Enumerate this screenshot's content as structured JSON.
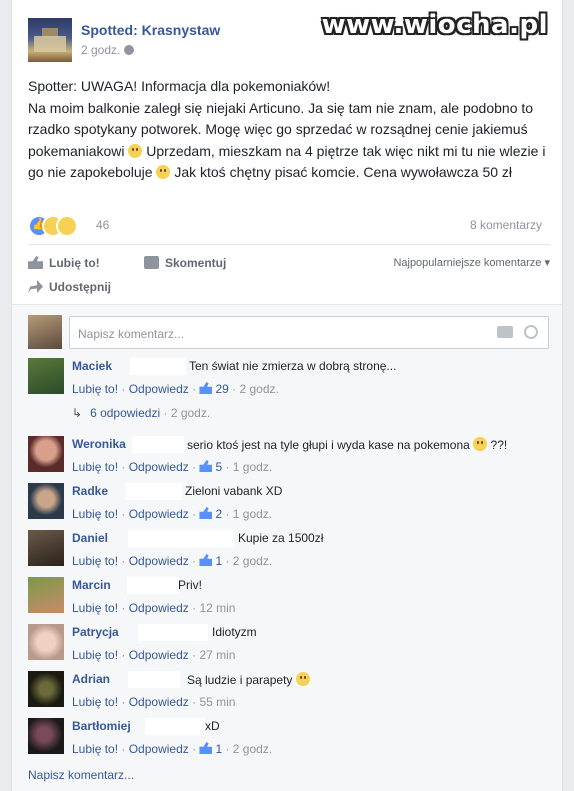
{
  "watermark": "www.wiocha.pl",
  "post": {
    "page_name": "Spotted: Krasnystaw",
    "time": "2 godz.",
    "text_p1": "Spotter: UWAGA! Informacja dla pokemoniaków!",
    "text_p2a": "Na moim balkonie zaległ się niejaki Articuno. Ja się tam nie znam, ale podobno to rzadko spotykany potworek. Mogę więc go sprzedać w rozsądnej cenie jakiemuś pokemaniakowi",
    "text_p2b": "Uprzedam, mieszkam na 4 piętrze tak więc nikt mi tu nie wlezie i go nie zapokeboluje",
    "text_p2c": "Jak ktoś chętny pisać komcie. Cena wywoławcza 50 zł",
    "reactions_count": "46",
    "comments_count": "8 komentarzy"
  },
  "actions": {
    "like": "Lubię to!",
    "comment": "Skomentuj",
    "share": "Udostępnij",
    "sort": "Najpopularniejsze komentarze"
  },
  "composer": {
    "placeholder": "Napisz komentarz..."
  },
  "comments": [
    {
      "name": "Maciek",
      "text": "Ten świat nie zmierza w dobrą stronę...",
      "like": "Lubię to!",
      "reply": "Odpowiedz",
      "likes": "29",
      "time": "2 godz."
    },
    {
      "name": "Weronika",
      "text": "serio ktoś jest na tyle głupi i wyda kase na pokemona",
      "text_after": "??!",
      "like": "Lubię to!",
      "reply": "Odpowiedz",
      "likes": "5",
      "time": "1 godz."
    },
    {
      "name": "Radke",
      "text": "Zieloni vabank XD",
      "like": "Lubię to!",
      "reply": "Odpowiedz",
      "likes": "2",
      "time": "1 godz."
    },
    {
      "name": "Daniel",
      "text": "Kupie za 1500zł",
      "like": "Lubię to!",
      "reply": "Odpowiedz",
      "likes": "1",
      "time": "2 godz."
    },
    {
      "name": "Marcin",
      "text": "Priv!",
      "like": "Lubię to!",
      "reply": "Odpowiedz",
      "likes": "",
      "time": "12 min"
    },
    {
      "name": "Patrycja",
      "text": "Idiotyzm",
      "like": "Lubię to!",
      "reply": "Odpowiedz",
      "likes": "",
      "time": "27 min"
    },
    {
      "name": "Adrian",
      "text": "Są ludzie i parapety",
      "like": "Lubię to!",
      "reply": "Odpowiedz",
      "likes": "",
      "time": "55 min"
    },
    {
      "name": "Bartłomiej",
      "text": "xD",
      "like": "Lubię to!",
      "reply": "Odpowiedz",
      "likes": "1",
      "time": "2 godz."
    }
  ],
  "replies": {
    "label": "6 odpowiedzi",
    "time": "2 godz."
  },
  "write_comment": "Napisz komentarz...",
  "colors": {
    "link": "#365899",
    "muted": "#90949c",
    "background": "#e9ebee"
  }
}
